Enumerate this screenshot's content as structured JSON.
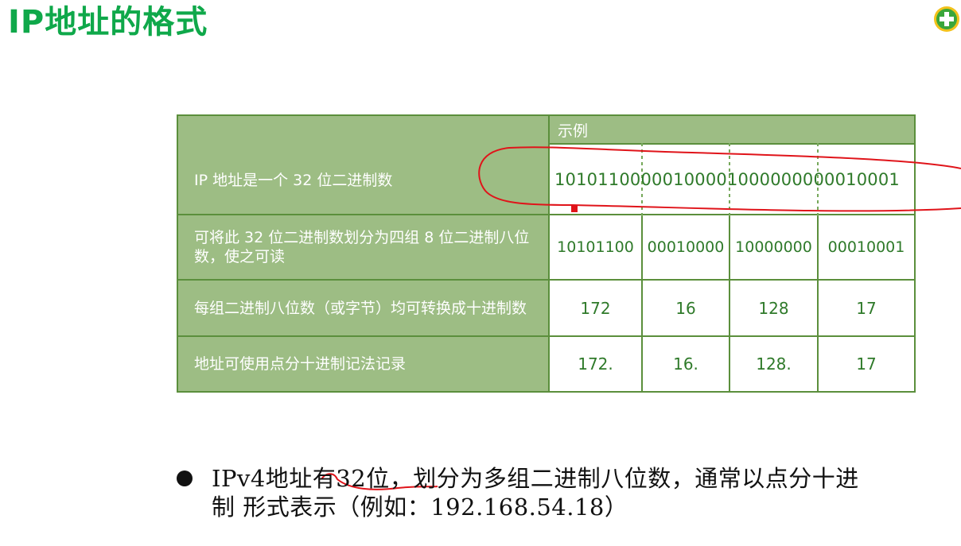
{
  "title": "IP地址的格式",
  "logo_icon": "plus-logo-icon",
  "colors": {
    "title": "#0fa84a",
    "table_fill": "#9dbd84",
    "table_border": "#5b8f3c",
    "value_text": "#2f7a2a",
    "annotation": "#e0141a"
  },
  "table": {
    "header": "示例",
    "rows": [
      {
        "label": "IP 地址是一个 32 位二进制数",
        "binary_full": "10101100000100001000000000010001"
      },
      {
        "label": "可将此 32 位二进制数划分为四组 8 位二进制八位数，使之可读",
        "values": [
          "10101100",
          "00010000",
          "10000000",
          "00010001"
        ]
      },
      {
        "label": "每组二进制八位数（或字节）均可转换成十进制数",
        "values": [
          "172",
          "16",
          "128",
          "17"
        ]
      },
      {
        "label": "地址可使用点分十进制记法记录",
        "values": [
          "172.",
          "16.",
          "128.",
          "17"
        ]
      }
    ]
  },
  "bullet_text": {
    "line1": "IPv4地址有32位，划分为多组二进制八位数，通常以点分十进",
    "line2": "制 形式表示（例如：192.168.54.18）"
  }
}
